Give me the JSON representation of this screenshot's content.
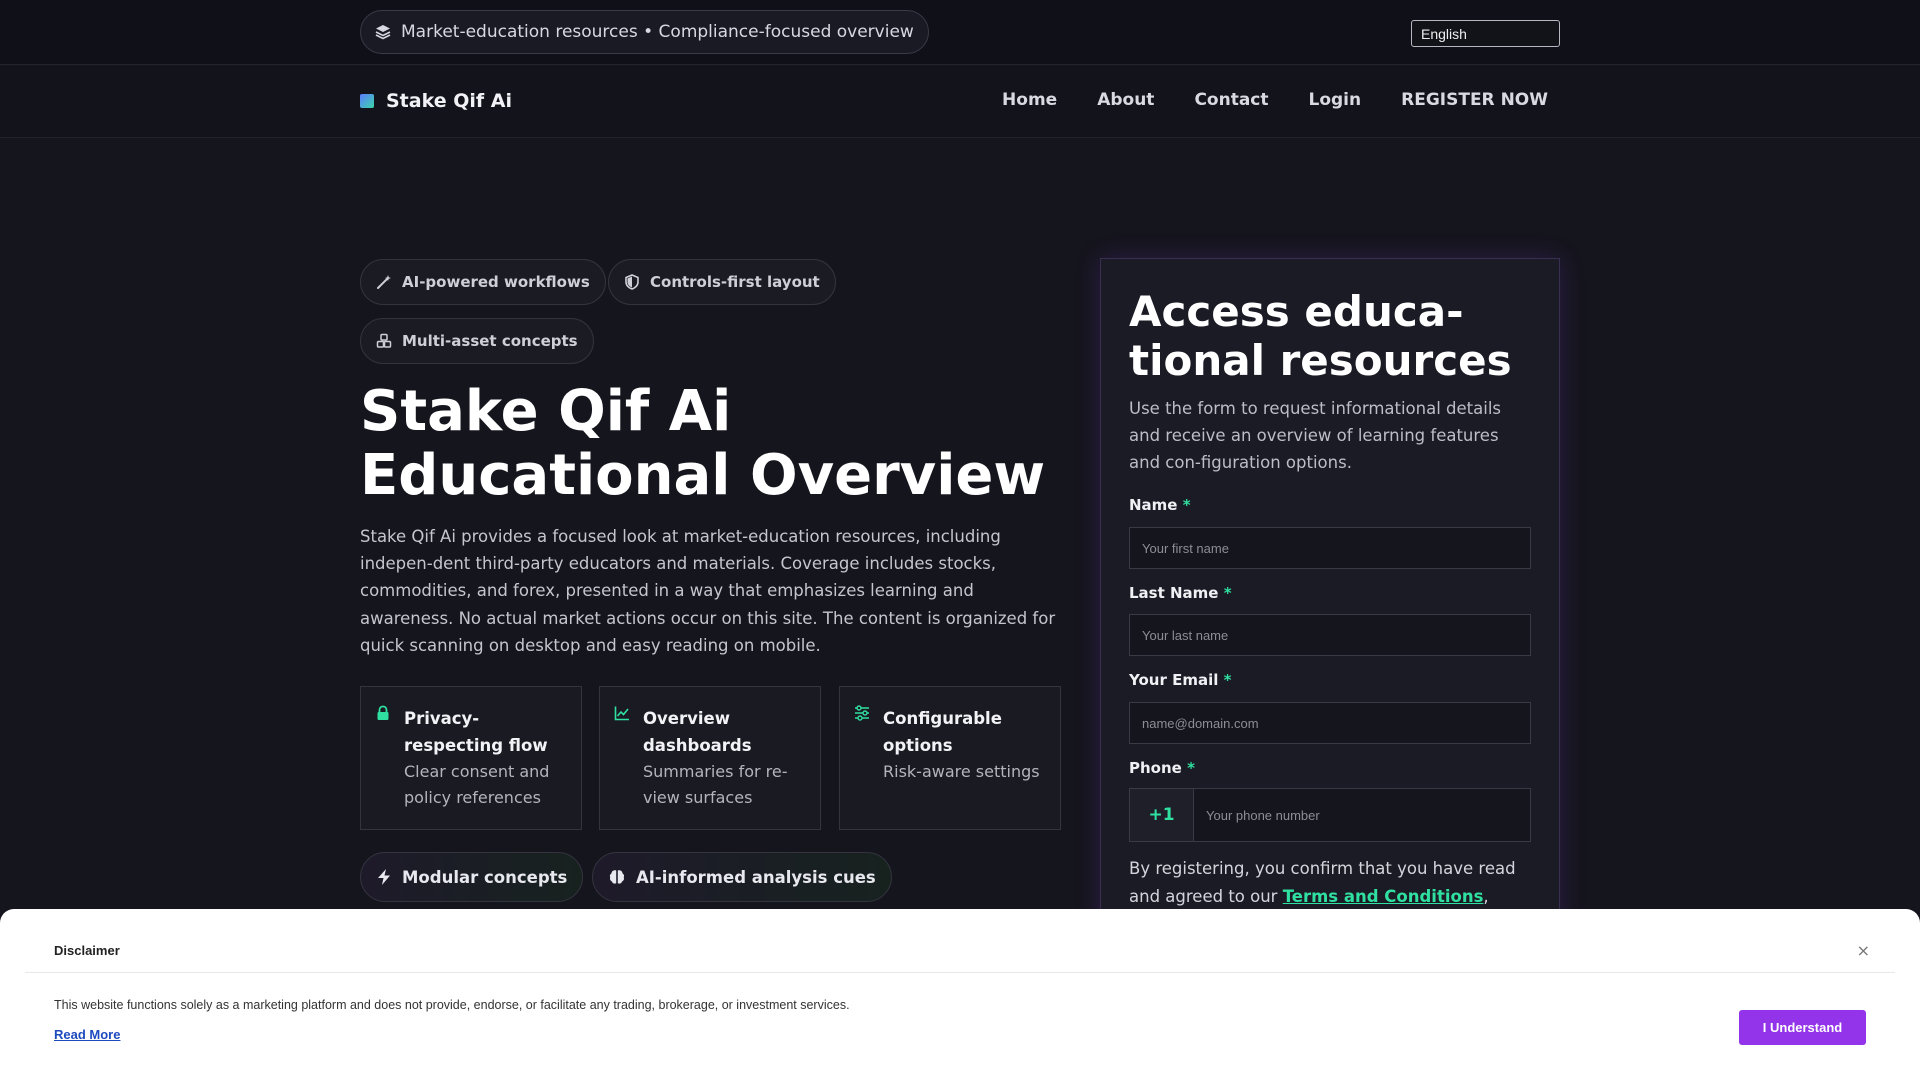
{
  "topbar": {
    "announcement": "Market-education resources • Compliance-focused overview",
    "language": "English"
  },
  "nav": {
    "brand": "Stake Qif Ai",
    "items": [
      "Home",
      "About",
      "Contact",
      "Login",
      "REGISTER NOW"
    ]
  },
  "hero": {
    "tags": [
      "AI-powered workflows",
      "Controls-first layout",
      "Multi-asset concepts"
    ],
    "title": "Stake Qif Ai Educational Overview",
    "lead": "Stake Qif Ai provides a focused look at market-education resources, including indepen-dent third-party educators and materials. Coverage includes stocks, commodities, and forex, presented in a way that emphasizes learning and awareness. No actual market actions occur on this site. The content is organized for quick scanning on desktop and easy reading on mobile.",
    "cards": [
      {
        "title": "Privacy-respecting flow",
        "subtitle": "Clear consent and policy references",
        "icon": "lock-icon"
      },
      {
        "title": "Overview dashboards",
        "subtitle": "Summaries for re-view surfaces",
        "icon": "chart-line-icon"
      },
      {
        "title": "Configurable options",
        "subtitle": "Risk-aware settings",
        "icon": "sliders-icon"
      }
    ],
    "chips": [
      "Modular concepts",
      "AI-informed analysis cues"
    ]
  },
  "form": {
    "title": "Access educa-tional resources",
    "description": "Use the form to request informational details and receive an overview of learning features and con-figuration options.",
    "name_label": "Name",
    "name_placeholder": "Your first name",
    "last_name_label": "Last Name",
    "last_name_placeholder": "Your last name",
    "email_label": "Your Email",
    "email_placeholder": "name@domain.com",
    "phone_label": "Phone",
    "phone_code": "+1",
    "phone_placeholder": "Your phone number",
    "required_mark": "*",
    "consent_text": "By registering, you confirm that you have read and agreed to our ",
    "terms_link": "Terms and Conditions",
    "accent": "#2fe0a0"
  },
  "disclaimer": {
    "heading": "Disclaimer",
    "close": "×",
    "text": "This website functions solely as a marketing platform and does not provide, endorse, or facilitate any trading, brokerage, or investment services.",
    "read_more": "Read More",
    "button": "I Understand",
    "button_color": "#9333ea"
  }
}
